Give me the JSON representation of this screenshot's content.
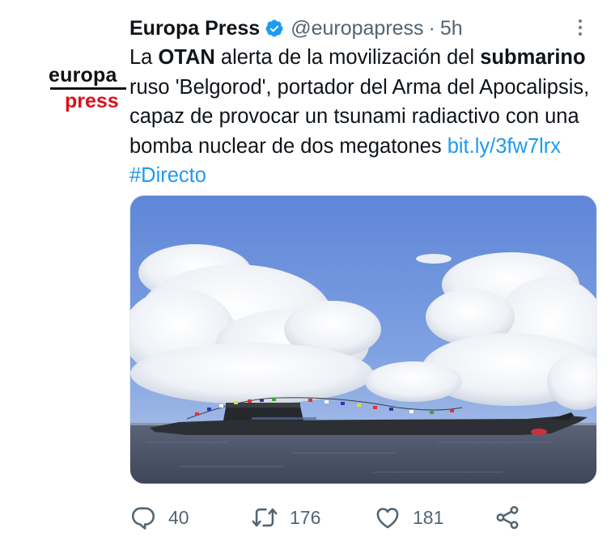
{
  "account": {
    "display_name": "Europa Press",
    "handle": "@europapress",
    "separator": "·",
    "time": "5h",
    "avatar_logo_top": "europa",
    "avatar_logo_bottom": "press",
    "verified_icon": "verified-badge-icon",
    "logo_red": "#d8121c"
  },
  "tweet": {
    "text_1": "La ",
    "text_bold_1": "OTAN",
    "text_2": " alerta de la movilización del ",
    "text_bold_2": "submarino",
    "text_3": " ruso 'Belgorod', portador del Arma del Apocalipsis, capaz de provocar un tsunami radiactivo con una bomba nuclear de dos megatones ",
    "link": "bit.ly/3fw7lrx",
    "space": " ",
    "hashtag": "#Directo",
    "link_color": "#1d9bf0"
  },
  "media": {
    "description_icon": "submarine-photo"
  },
  "actions": {
    "reply_count": "40",
    "retweet_count": "176",
    "like_count": "181",
    "icons": [
      "reply-icon",
      "retweet-icon",
      "like-icon",
      "share-icon"
    ]
  }
}
